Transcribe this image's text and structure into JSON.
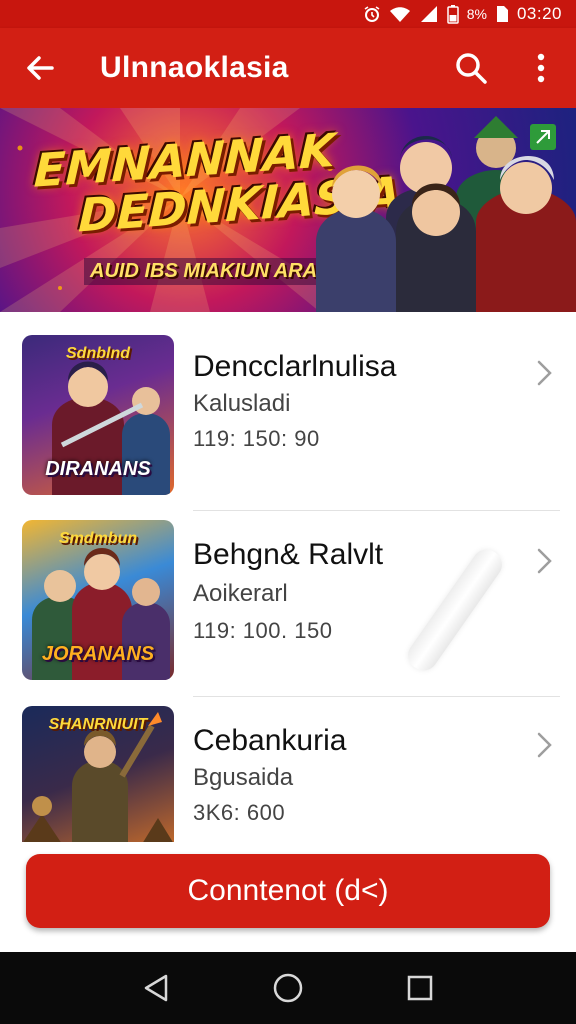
{
  "status_bar": {
    "battery_text": "8%",
    "time": "03:20",
    "icons": [
      "alarm-icon",
      "wifi-icon",
      "signal-icon",
      "battery-icon"
    ]
  },
  "app_bar": {
    "title": "Ulnnaoklasia",
    "back_icon": "arrow-left-icon",
    "search_icon": "search-icon",
    "menu_icon": "more-vert-icon"
  },
  "banner": {
    "title_line1": "EMNANNAK",
    "title_line2": "DEDNKIASIA",
    "tagline": "AUID IBS MIAKIUN ARAKAYRIER"
  },
  "games": [
    {
      "name": "Dencclarlnulisa",
      "subtitle": "Kalusladi",
      "meta": "119: 150:   90",
      "thumb_top": "Sdnblnd",
      "thumb_label": "DIRANANS"
    },
    {
      "name": "Behgn& Ralvlt",
      "subtitle": "Aoikerarl",
      "meta": "119: 100.   150",
      "thumb_top": "Smdmbun",
      "thumb_label": "JORANANS"
    },
    {
      "name": "Cebankuria",
      "subtitle": "Bgusaida",
      "meta": "3K6: 600",
      "thumb_top": "SHANRNIUIT",
      "thumb_label": ""
    }
  ],
  "cta": {
    "label": "Conntenot (d<)"
  },
  "nav_bar": {
    "icons": [
      "nav-back-icon",
      "nav-home-icon",
      "nav-recents-icon"
    ]
  },
  "colors": {
    "primary": "#d21f14",
    "status_bar": "#c8160e",
    "nav_bar": "#0a0a0a"
  }
}
